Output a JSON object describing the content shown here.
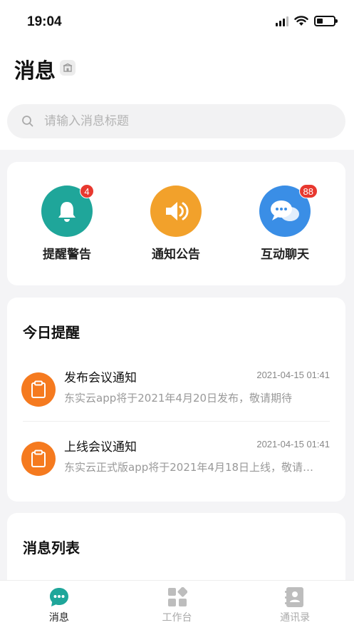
{
  "status_bar": {
    "time": "19:04"
  },
  "header": {
    "title": "消息"
  },
  "search": {
    "placeholder": "请输入消息标题"
  },
  "quick_actions": [
    {
      "label": "提醒警告",
      "badge": "4",
      "color": "#1fa69a",
      "icon": "bell-icon"
    },
    {
      "label": "通知公告",
      "badge": "",
      "color": "#f2a12b",
      "icon": "speaker-icon"
    },
    {
      "label": "互动聊天",
      "badge": "88",
      "color": "#3a8ee6",
      "icon": "chat-icon"
    }
  ],
  "today": {
    "title": "今日提醒",
    "items": [
      {
        "title": "发布会议通知",
        "time": "2021-04-15 01:41",
        "body": "东实云app将于2021年4月20日发布，敬请期待",
        "icon": "clipboard-icon"
      },
      {
        "title": "上线会议通知",
        "time": "2021-04-15 01:41",
        "body": "东实云正式版app将于2021年4月18日上线，敬请期待",
        "icon": "clipboard-icon"
      }
    ]
  },
  "message_list": {
    "title": "消息列表"
  },
  "tabbar": {
    "items": [
      {
        "label": "消息",
        "icon": "message-icon",
        "active": true
      },
      {
        "label": "工作台",
        "icon": "workbench-icon",
        "active": false
      },
      {
        "label": "通讯录",
        "icon": "contacts-icon",
        "active": false
      }
    ]
  },
  "colors": {
    "accent": "#1fa69a",
    "badge": "#e8382f",
    "msg_icon": "#f57a1f"
  }
}
